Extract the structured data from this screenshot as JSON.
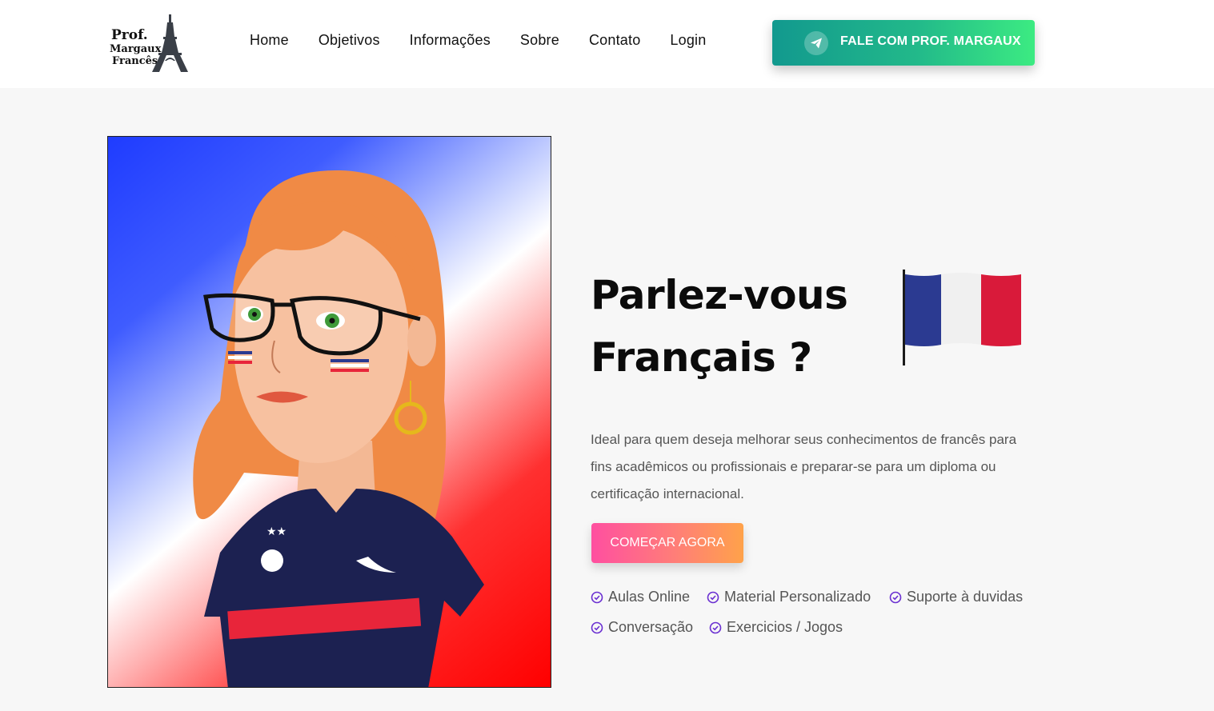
{
  "brand": {
    "line1": "Prof.",
    "line2": "Margaux",
    "line3": "Francês",
    "logo_icon": "eiffel-tower-icon"
  },
  "nav": {
    "items": [
      "Home",
      "Objetivos",
      "Informações",
      "Sobre",
      "Contato",
      "Login"
    ]
  },
  "header_cta": {
    "label": "FALE COM PROF. MARGAUX",
    "icon": "telegram-icon"
  },
  "hero": {
    "title_line1": "Parlez-vous",
    "title_line2": "Français ?",
    "description": "Ideal para quem deseja melhorar seus conhecimentos de francês para fins acadêmicos ou profissionais e preparar-se para um diploma ou certificação internacional.",
    "cta_label": "COMEÇAR AGORA"
  },
  "features": [
    "Aulas Online",
    "Material Personalizado",
    "Suporte à duvidas",
    "Conversação",
    "Exercicios / Jogos"
  ],
  "colors": {
    "header_cta_gradient": [
      "#12998e",
      "#3ceb82"
    ],
    "main_cta_gradient": [
      "#ff4fa0",
      "#ffa24a"
    ],
    "check_icon": "#6a2fd1",
    "flag": [
      "#2b3a91",
      "#f0f0f0",
      "#d91a3a"
    ]
  }
}
